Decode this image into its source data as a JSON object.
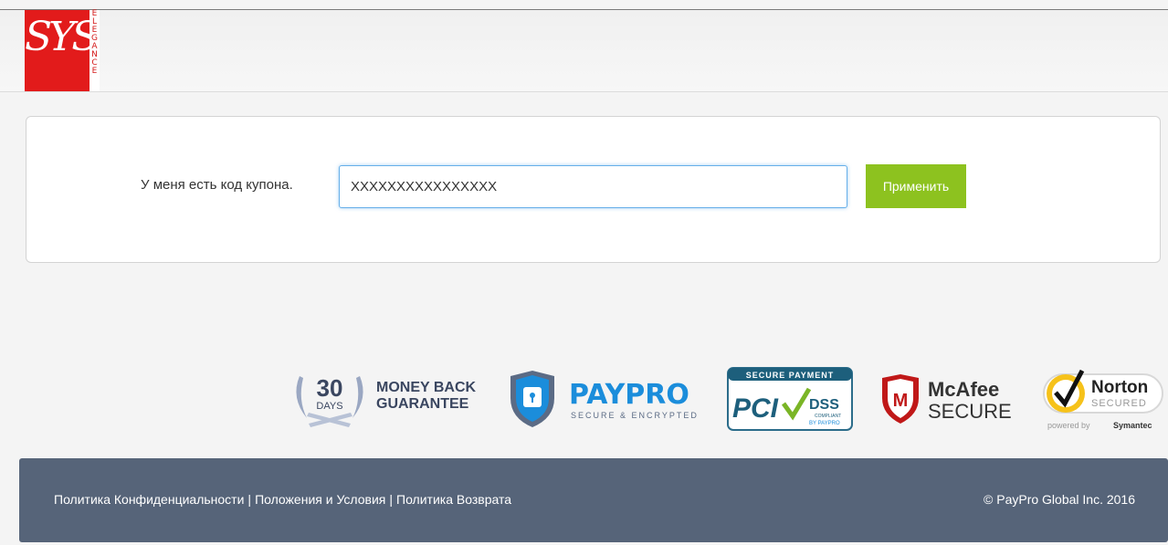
{
  "header": {
    "logo": {
      "main_text": "SYS",
      "side_text": "ELEGANCE"
    }
  },
  "coupon": {
    "label": "У меня есть код купона.",
    "input_value": "XXXXXXXXXXXXXXXX",
    "apply_label": "Применить"
  },
  "badges": {
    "money_back": {
      "days_number": "30",
      "days_label": "DAYS",
      "line1": "MONEY BACK",
      "line2": "GUARANTEE"
    },
    "paypro": {
      "name": "PAYPRO",
      "tagline": "SECURE & ENCRYPTED"
    },
    "pci": {
      "banner": "SECURE PAYMENT",
      "pci": "PCI",
      "dss": "DSS",
      "compliant": "COMPLIANT",
      "by": "BY PAYPRO"
    },
    "mcafee": {
      "line1": "McAfee",
      "line2": "SECURE"
    },
    "norton": {
      "name": "Norton",
      "secured": "SECURED",
      "powered": "powered by",
      "brand": "Symantec"
    }
  },
  "footer": {
    "links": [
      "Политика Конфиденциальности",
      "Положения и Условия",
      "Политика Возврата"
    ],
    "separator": "|",
    "copyright": "© PayPro Global Inc. 2016"
  },
  "colors": {
    "accent_green": "#8dc21f",
    "footer_bg": "#566479",
    "logo_red": "#e21b1b",
    "input_focus": "#66afe9"
  }
}
